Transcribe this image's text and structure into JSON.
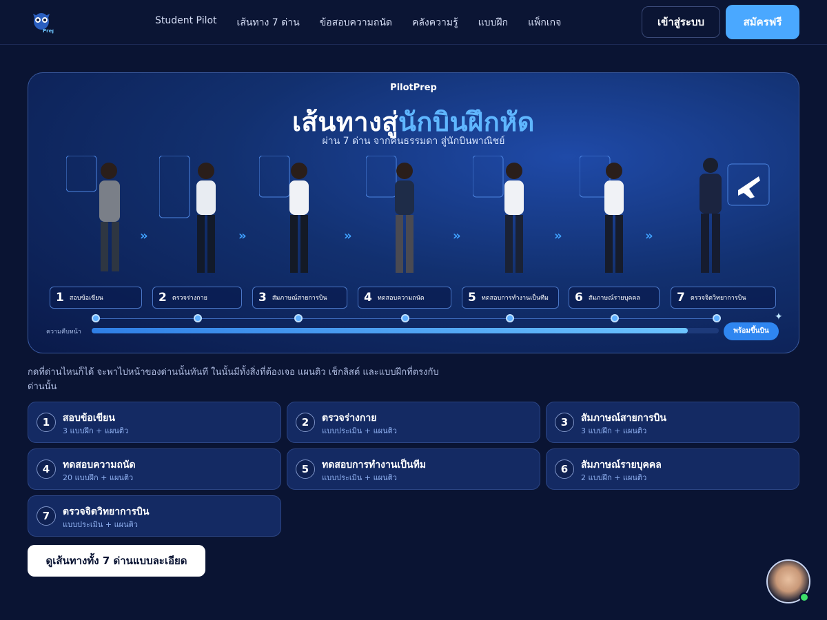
{
  "header": {
    "logo_text": "Prep",
    "nav": [
      {
        "label": "Student Pilot"
      },
      {
        "label": "เส้นทาง 7 ด่าน"
      },
      {
        "label": "ข้อสอบความถนัด"
      },
      {
        "label": "คลังความรู้"
      },
      {
        "label": "แบบฝึก"
      },
      {
        "label": "แพ็กเกจ"
      }
    ],
    "login_label": "เข้าสู่ระบบ",
    "signup_label": "สมัครฟรี"
  },
  "hero": {
    "brand": "PilotPrep",
    "title_main": "เส้นทางสู่",
    "title_accent": "นักบินฝึกหัด",
    "subtitle": "ผ่าน 7 ด่าน จากคนธรรมดา สู่นักบินพาณิชย์",
    "stages": [
      {
        "n": "1",
        "label": "สอบข้อเขียน"
      },
      {
        "n": "2",
        "label": "ตรวจร่างกาย"
      },
      {
        "n": "3",
        "label": "สัมภาษณ์สายการบิน"
      },
      {
        "n": "4",
        "label": "ทดสอบความถนัด"
      },
      {
        "n": "5",
        "label": "ทดสอบการทำงานเป็นทีม"
      },
      {
        "n": "6",
        "label": "สัมภาษณ์รายบุคคล"
      },
      {
        "n": "7",
        "label": "ตรวจจิตวิทยาการบิน"
      }
    ],
    "progress_label": "ความคืบหน้า",
    "progress_fraction": 0.95,
    "ready_label": "พร้อมขึ้นบิน"
  },
  "description": "กดที่ด่านไหนก็ได้ จะพาไปหน้าของด่านนั้นทันที ในนั้นมีทั้งสิ่งที่ต้องเจอ แผนติว เช็กลิสต์ และแบบฝึกที่ตรงกับด่านนั้น",
  "cards": [
    {
      "n": "1",
      "title": "สอบข้อเขียน",
      "sub": "3 แบบฝึก + แผนติว"
    },
    {
      "n": "2",
      "title": "ตรวจร่างกาย",
      "sub": "แบบประเมิน + แผนติว"
    },
    {
      "n": "3",
      "title": "สัมภาษณ์สายการบิน",
      "sub": "3 แบบฝึก + แผนติว"
    },
    {
      "n": "4",
      "title": "ทดสอบความถนัด",
      "sub": "20 แบบฝึก + แผนติว"
    },
    {
      "n": "5",
      "title": "ทดสอบการทำงานเป็นทีม",
      "sub": "แบบประเมิน + แผนติว"
    },
    {
      "n": "6",
      "title": "สัมภาษณ์รายบุคคล",
      "sub": "2 แบบฝึก + แผนติว"
    },
    {
      "n": "7",
      "title": "ตรวจจิตวิทยาการบิน",
      "sub": "แบบประเมิน + แผนติว"
    }
  ],
  "cta_label": "ดูเส้นทางทั้ง 7 ด่านแบบละเอียด"
}
